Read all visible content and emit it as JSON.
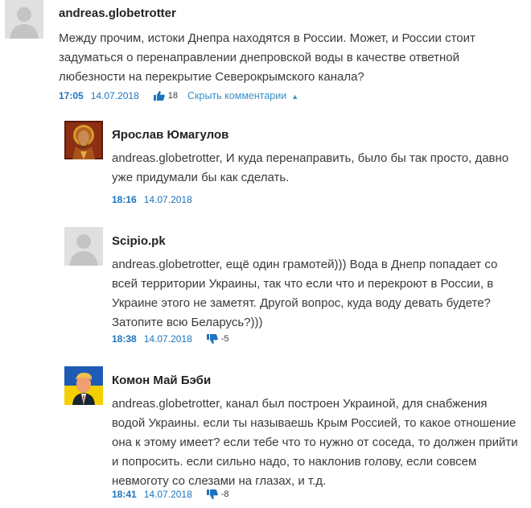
{
  "comments": [
    {
      "author": "andreas.globetrotter",
      "text": "Между прочим, истоки Днепра находятся в России. Может, и России стоит задуматься о перенаправлении днепровской воды в качестве ответной любезности на перекрытие Северокрымского канала?",
      "time": "17:05",
      "date": "14.07.2018",
      "vote_icon": "thumbs-up-icon",
      "votes": "18",
      "hide_label": "Скрыть комментарии",
      "avatar": "default-avatar"
    },
    {
      "author": "Ярослав Юмагулов",
      "text": "andreas.globetrotter, И куда перенаправить, было бы так просто, давно уже придумали бы как сделать.",
      "time": "18:16",
      "date": "14.07.2018",
      "avatar": "icon-avatar"
    },
    {
      "author": "Scipio.pk",
      "text": "andreas.globetrotter, ещё один грамотей))) Вода в Днепр попадает со всей территории Украины, так что если что и перекроют в России, в Украине этого не заметят. Другой вопрос, куда воду девать будете? Затопите всю Беларусь?)))",
      "time": "18:38",
      "date": "14.07.2018",
      "vote_icon": "thumbs-down-icon",
      "votes": "-5",
      "avatar": "default-avatar"
    },
    {
      "author": "Комон Май Бэби",
      "text": "andreas.globetrotter, канал был построен Украиной, для снабжения водой Украины. если ты называешь Крым Россией, то какое отношение она к этому имеет? если тебе что то нужно от соседа, то должен прийти и попросить. если сильно надо, то наклонив голову, если совсем невмоготу со слезами на глазах, и т.д.",
      "time": "18:41",
      "date": "14.07.2018",
      "vote_icon": "thumbs-down-icon",
      "votes": "-8",
      "avatar": "flag-portrait-avatar"
    }
  ],
  "colors": {
    "link_blue": "#1e73be",
    "hide_blue": "#3a90c8",
    "text": "#3a3a3a",
    "avatar_gray": "#e0e0e0",
    "flag_blue": "#1f5bb5",
    "flag_yellow": "#f5d000"
  }
}
